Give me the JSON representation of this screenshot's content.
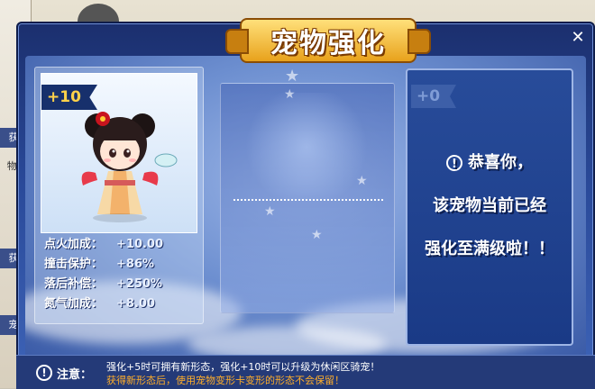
{
  "window": {
    "title": "宠物强化",
    "close_label": "✕"
  },
  "pet": {
    "level_badge": "+10",
    "stats": [
      {
        "label": "点火加成：",
        "value": "+10.00"
      },
      {
        "label": "撞击保护：",
        "value": "+86%"
      },
      {
        "label": "落后补偿：",
        "value": "+250%"
      },
      {
        "label": "氮气加成：",
        "value": "+8.00"
      }
    ]
  },
  "result": {
    "level_badge": "+0",
    "message_lines": [
      "恭喜你，",
      "该宠物当前已经",
      "强化至满级啦！！"
    ]
  },
  "footer": {
    "label": "注意：",
    "line1": "强化+5时可拥有新形态，强化+10时可以升级为休闲区骑宠！",
    "line2": "获得新形态后，使用宠物变形卡变形的形态不会保留！"
  },
  "background": {
    "tabs": [
      "获",
      "物.",
      "获",
      "宠"
    ]
  },
  "colors": {
    "accent_gold": "#ffd24a",
    "warning_orange": "#ffae2a",
    "panel_blue": "#1a3a86"
  }
}
